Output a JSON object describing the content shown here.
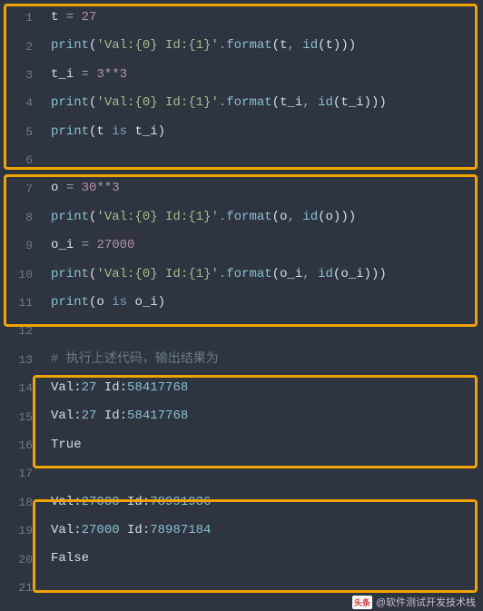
{
  "footer": {
    "brand": "头条",
    "account": "@软件测试开发技术栈"
  },
  "lines": [
    {
      "n": 1,
      "tokens": [
        [
          "ident",
          "t"
        ],
        [
          "sp",
          " "
        ],
        [
          "op",
          "="
        ],
        [
          "sp",
          " "
        ],
        [
          "num",
          "27"
        ]
      ]
    },
    {
      "n": 2,
      "tokens": [
        [
          "func",
          "print"
        ],
        [
          "paren",
          "("
        ],
        [
          "str",
          "'Val:{0} Id:{1}'"
        ],
        [
          "op",
          "."
        ],
        [
          "builtin",
          "format"
        ],
        [
          "paren",
          "("
        ],
        [
          "ident",
          "t"
        ],
        [
          "op",
          ","
        ],
        [
          "sp",
          " "
        ],
        [
          "builtin",
          "id"
        ],
        [
          "paren",
          "("
        ],
        [
          "ident",
          "t"
        ],
        [
          "paren",
          ")"
        ],
        [
          "paren",
          ")"
        ],
        [
          "paren",
          ")"
        ]
      ]
    },
    {
      "n": 3,
      "tokens": [
        [
          "ident",
          "t_i"
        ],
        [
          "sp",
          " "
        ],
        [
          "op",
          "="
        ],
        [
          "sp",
          " "
        ],
        [
          "num",
          "3"
        ],
        [
          "op",
          "**"
        ],
        [
          "num",
          "3"
        ]
      ]
    },
    {
      "n": 4,
      "tokens": [
        [
          "func",
          "print"
        ],
        [
          "paren",
          "("
        ],
        [
          "str",
          "'Val:{0} Id:{1}'"
        ],
        [
          "op",
          "."
        ],
        [
          "builtin",
          "format"
        ],
        [
          "paren",
          "("
        ],
        [
          "ident",
          "t_i"
        ],
        [
          "op",
          ","
        ],
        [
          "sp",
          " "
        ],
        [
          "builtin",
          "id"
        ],
        [
          "paren",
          "("
        ],
        [
          "ident",
          "t_i"
        ],
        [
          "paren",
          ")"
        ],
        [
          "paren",
          ")"
        ],
        [
          "paren",
          ")"
        ]
      ]
    },
    {
      "n": 5,
      "tokens": [
        [
          "func",
          "print"
        ],
        [
          "paren",
          "("
        ],
        [
          "ident",
          "t"
        ],
        [
          "sp",
          " "
        ],
        [
          "kw",
          "is"
        ],
        [
          "sp",
          " "
        ],
        [
          "ident",
          "t_i"
        ],
        [
          "paren",
          ")"
        ]
      ]
    },
    {
      "n": 6,
      "tokens": []
    },
    {
      "n": 7,
      "tokens": [
        [
          "ident",
          "o"
        ],
        [
          "sp",
          " "
        ],
        [
          "op",
          "="
        ],
        [
          "sp",
          " "
        ],
        [
          "num",
          "30"
        ],
        [
          "op",
          "**"
        ],
        [
          "num",
          "3"
        ]
      ]
    },
    {
      "n": 8,
      "tokens": [
        [
          "func",
          "print"
        ],
        [
          "paren",
          "("
        ],
        [
          "str",
          "'Val:{0} Id:{1}'"
        ],
        [
          "op",
          "."
        ],
        [
          "builtin",
          "format"
        ],
        [
          "paren",
          "("
        ],
        [
          "ident",
          "o"
        ],
        [
          "op",
          ","
        ],
        [
          "sp",
          " "
        ],
        [
          "builtin",
          "id"
        ],
        [
          "paren",
          "("
        ],
        [
          "ident",
          "o"
        ],
        [
          "paren",
          ")"
        ],
        [
          "paren",
          ")"
        ],
        [
          "paren",
          ")"
        ]
      ]
    },
    {
      "n": 9,
      "tokens": [
        [
          "ident",
          "o_i"
        ],
        [
          "sp",
          " "
        ],
        [
          "op",
          "="
        ],
        [
          "sp",
          " "
        ],
        [
          "num",
          "27000"
        ]
      ]
    },
    {
      "n": 10,
      "tokens": [
        [
          "func",
          "print"
        ],
        [
          "paren",
          "("
        ],
        [
          "str",
          "'Val:{0} Id:{1}'"
        ],
        [
          "op",
          "."
        ],
        [
          "builtin",
          "format"
        ],
        [
          "paren",
          "("
        ],
        [
          "ident",
          "o_i"
        ],
        [
          "op",
          ","
        ],
        [
          "sp",
          " "
        ],
        [
          "builtin",
          "id"
        ],
        [
          "paren",
          "("
        ],
        [
          "ident",
          "o_i"
        ],
        [
          "paren",
          ")"
        ],
        [
          "paren",
          ")"
        ],
        [
          "paren",
          ")"
        ]
      ]
    },
    {
      "n": 11,
      "tokens": [
        [
          "func",
          "print"
        ],
        [
          "paren",
          "("
        ],
        [
          "ident",
          "o"
        ],
        [
          "sp",
          " "
        ],
        [
          "kw",
          "is"
        ],
        [
          "sp",
          " "
        ],
        [
          "ident",
          "o_i"
        ],
        [
          "paren",
          ")"
        ]
      ]
    },
    {
      "n": 12,
      "tokens": []
    },
    {
      "n": 13,
      "tokens": [
        [
          "comment",
          "# 执行上述代码，输出结果为"
        ]
      ]
    },
    {
      "n": 14,
      "tokens": [
        [
          "outlbl",
          "Val:"
        ],
        [
          "outnum",
          "27"
        ],
        [
          "sp",
          " "
        ],
        [
          "outlbl",
          "Id:"
        ],
        [
          "outnum",
          "58417768"
        ]
      ]
    },
    {
      "n": 15,
      "tokens": [
        [
          "outlbl",
          "Val:"
        ],
        [
          "outnum",
          "27"
        ],
        [
          "sp",
          " "
        ],
        [
          "outlbl",
          "Id:"
        ],
        [
          "outnum",
          "58417768"
        ]
      ]
    },
    {
      "n": 16,
      "tokens": [
        [
          "true",
          "True"
        ]
      ]
    },
    {
      "n": 17,
      "tokens": []
    },
    {
      "n": 18,
      "tokens": [
        [
          "outlbl",
          "Val:"
        ],
        [
          "outnum",
          "27000"
        ],
        [
          "sp",
          " "
        ],
        [
          "outlbl",
          "Id:"
        ],
        [
          "outnum",
          "78991936"
        ]
      ]
    },
    {
      "n": 19,
      "tokens": [
        [
          "outlbl",
          "Val:"
        ],
        [
          "outnum",
          "27000"
        ],
        [
          "sp",
          " "
        ],
        [
          "outlbl",
          "Id:"
        ],
        [
          "outnum",
          "78987184"
        ]
      ]
    },
    {
      "n": 20,
      "tokens": [
        [
          "true",
          "False"
        ]
      ]
    },
    {
      "n": 21,
      "tokens": []
    }
  ]
}
